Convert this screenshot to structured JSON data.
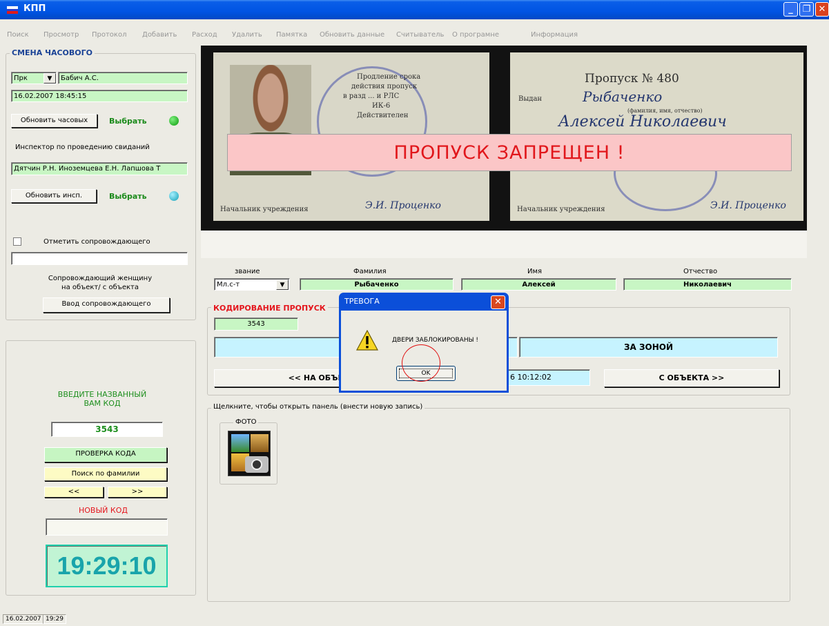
{
  "window": {
    "title": "КПП"
  },
  "menu": [
    "Поиск",
    "Просмотр",
    "Протокол",
    "Добавить",
    "Расход",
    "Удалить",
    "Памятка",
    "Обновить данные",
    "Считыватель",
    "О програмне",
    "Информация"
  ],
  "guard_shift": {
    "legend": "СМЕНА ЧАСОВОГО",
    "rank": "Прк",
    "name": "Бабич А.С.",
    "datetime": "16.02.2007 18:45:15",
    "refresh_guards": "Обновить часовых",
    "select_label": "Выбрать",
    "inspector_label": "Инспектор по проведению свиданий",
    "inspectors": "Дятчин Р.Н. Иноземцева Е.Н. Лапшова Т",
    "refresh_inspectors": "Обновить инсп.",
    "escort_checkbox_label": "Отметить сопровождающего",
    "escort_field": "",
    "escort_desc": "Сопровождающий женщину\nна объект/ с объекта",
    "escort_button": "Ввод сопровождающего"
  },
  "code_panel": {
    "prompt": "ВВЕДИТЕ НАЗВАННЫЙ\nВАМ КОД",
    "code_value": "3543",
    "check_button": "ПРОВЕРКА КОДА",
    "search_button": "Поиск по фамилии",
    "prev_button": "<<",
    "next_button": ">>",
    "new_code_label": "НОВЫЙ КОД",
    "new_code_value": "",
    "clock": "19:29:10"
  },
  "photo": {
    "doc_left_text": [
      "Продление срока",
      "действия пропуск",
      "в разд ... и РЛС",
      "ИК-6",
      "Действителен"
    ],
    "doc_left_footer": "Начальник учреждения",
    "doc_right_number": "Пропуск № 480",
    "doc_right_issued": "Выдан",
    "doc_right_surname": "Рыбаченко",
    "doc_right_hint": "(фамилия, имя, отчество)",
    "doc_right_given": "Алексей Николаевич",
    "doc_right_footer": "Начальник учреждения",
    "signature": "Э.И. Проценко",
    "banner": "ПРОПУСК   ЗАПРЕЩЕН !"
  },
  "person": {
    "rank_label": "звание",
    "surname_label": "Фамилия",
    "name_label": "Имя",
    "patronymic_label": "Отчество",
    "rank": "Мл.с-т",
    "surname": "Рыбаченко",
    "name": "Алексей",
    "patronymic": "Николаевич"
  },
  "pass_coding": {
    "legend": "КОДИРОВАНИЕ ПРОПУСК",
    "code": "3543",
    "zone_left": "",
    "zone_right": "ЗА ЗОНОЙ",
    "to_object": "<< НА ОБЪЕ",
    "time_partial": "6 10:12:02",
    "from_object": "С ОБЪЕКТА >>"
  },
  "records": {
    "legend": "Щелкните, чтобы открыть панель (внести новую запись)",
    "photo_legend": "ФОТО"
  },
  "dialog": {
    "title": "ТРЕВОГА",
    "message": "ДВЕРИ ЗАБЛОКИРОВАНЫ !",
    "ok": "OK"
  },
  "status": {
    "date": "16.02.2007",
    "time": "19:29"
  },
  "colors": {
    "field_green": "#c8f6c4",
    "alarm_red": "#e1171c",
    "banner_pink": "#fbc6c7",
    "clock_teal": "#19a4ab"
  }
}
